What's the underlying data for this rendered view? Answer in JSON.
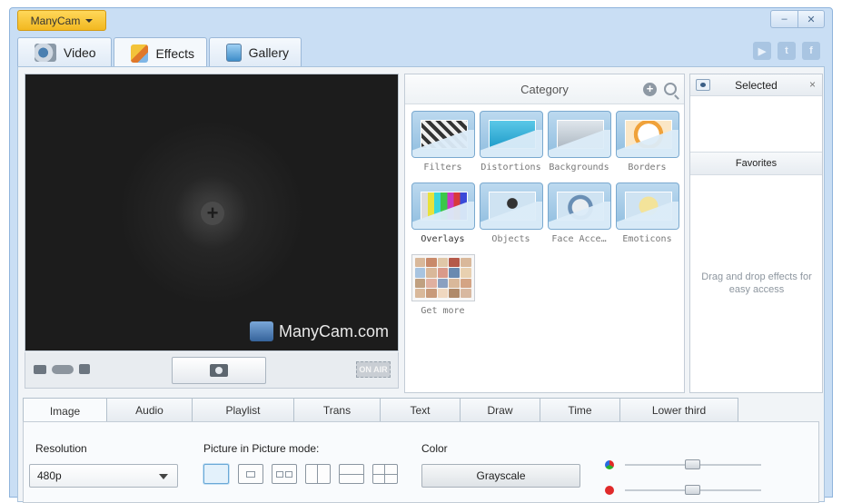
{
  "app": {
    "menu_label": "ManyCam"
  },
  "window": {
    "minimize_label": "–",
    "close_label": "✕"
  },
  "social": {
    "youtube": "▶",
    "twitter": "t",
    "facebook": "f"
  },
  "main_tabs": [
    {
      "label": "Video",
      "icon": "webcam-icon"
    },
    {
      "label": "Effects",
      "icon": "effects-icon"
    },
    {
      "label": "Gallery",
      "icon": "gallery-icon"
    }
  ],
  "preview": {
    "watermark": "ManyCam.com",
    "onair": "ON AIR",
    "add_symbol": "+"
  },
  "category": {
    "title": "Category",
    "folders": [
      {
        "label": "Filters"
      },
      {
        "label": "Distortions"
      },
      {
        "label": "Backgrounds"
      },
      {
        "label": "Borders"
      },
      {
        "label": "Overlays"
      },
      {
        "label": "Objects"
      },
      {
        "label": "Face Acce…"
      },
      {
        "label": "Emoticons"
      },
      {
        "label": "Get more"
      }
    ]
  },
  "selected": {
    "title": "Selected",
    "close": "×",
    "favorites_title": "Favorites",
    "hint": "Drag and drop effects for easy access"
  },
  "bottom_tabs": [
    "Image",
    "Audio",
    "Playlist",
    "Trans",
    "Text",
    "Draw",
    "Time",
    "Lower third"
  ],
  "image_settings": {
    "resolution_label": "Resolution",
    "resolution_value": "480p",
    "pip_label": "Picture in Picture mode:",
    "color_label": "Color",
    "grayscale_button": "Grayscale"
  },
  "colors": {
    "accent_orange": "#f2b820",
    "frame_blue": "#c9def4",
    "red_dot": "#e02a2a"
  }
}
